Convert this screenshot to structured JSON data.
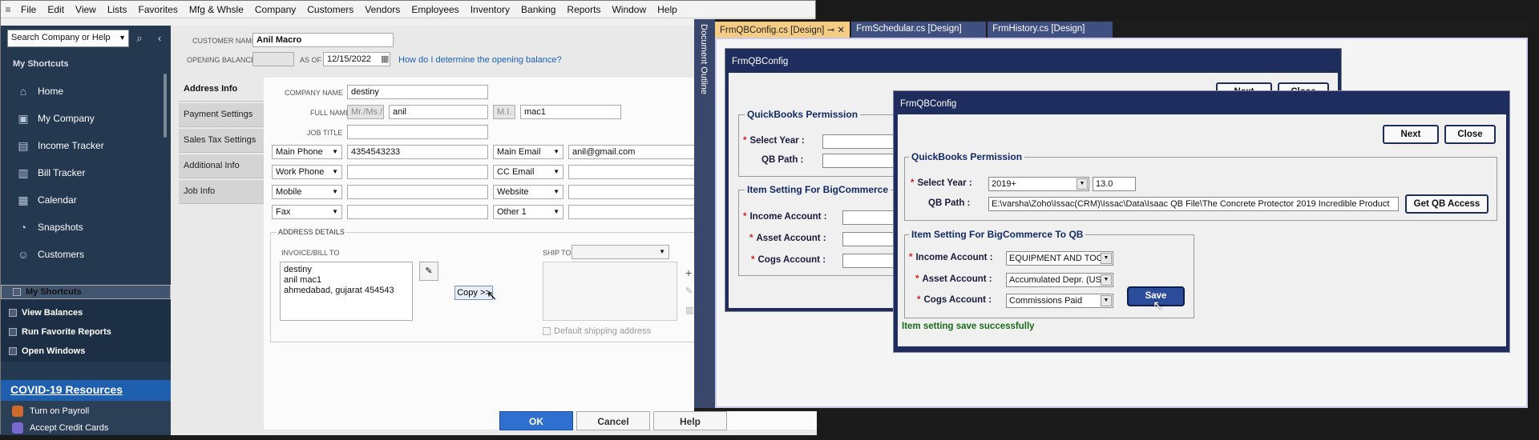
{
  "menu": [
    "File",
    "Edit",
    "View",
    "Lists",
    "Favorites",
    "Mfg & Whsle",
    "Company",
    "Customers",
    "Vendors",
    "Employees",
    "Inventory",
    "Banking",
    "Reports",
    "Window",
    "Help"
  ],
  "sidebar": {
    "search_placeholder": "Search Company or Help",
    "my_shortcuts_title": "My Shortcuts",
    "nav_items": [
      {
        "label": "Home",
        "icon": "home-icon",
        "glyph": "⌂"
      },
      {
        "label": "My Company",
        "icon": "company-icon",
        "glyph": "▣"
      },
      {
        "label": "Income Tracker",
        "icon": "income-tracker-icon",
        "glyph": "▤"
      },
      {
        "label": "Bill Tracker",
        "icon": "bill-tracker-icon",
        "glyph": "▥"
      },
      {
        "label": "Calendar",
        "icon": "calendar-icon",
        "glyph": "▦"
      },
      {
        "label": "Snapshots",
        "icon": "snapshots-icon",
        "glyph": "◔"
      },
      {
        "label": "Customers",
        "icon": "customers-icon",
        "glyph": "☺"
      }
    ],
    "shortcut_rows": [
      "My Shortcuts",
      "View Balances",
      "Run Favorite Reports",
      "Open Windows"
    ],
    "covid": "COVID-19 Resources",
    "payroll": "Turn on Payroll",
    "credit_cards": "Accept Credit Cards"
  },
  "customer": {
    "name_label": "CUSTOMER NAME",
    "name": "Anil Macro",
    "opening_balance_label": "OPENING BALANCE",
    "as_of_label": "AS OF",
    "as_of_date": "12/15/2022",
    "help_link": "How do I determine the opening balance?"
  },
  "tabs": [
    "Address Info",
    "Payment Settings",
    "Sales Tax Settings",
    "Additional Info",
    "Job Info"
  ],
  "address_info": {
    "company_label": "COMPANY NAME",
    "company": "destiny",
    "full_name_label": "FULL NAME",
    "mr_placeholder": "Mr./Ms./...",
    "first_name": "anil",
    "mi_placeholder": "M.I.",
    "last_name": "mac1",
    "job_title_label": "JOB TITLE",
    "phones": [
      {
        "type": "Main Phone",
        "value": "4354543233",
        "type2": "Main Email",
        "value2": "anil@gmail.com"
      },
      {
        "type": "Work Phone",
        "value": "",
        "type2": "CC Email",
        "value2": ""
      },
      {
        "type": "Mobile",
        "value": "",
        "type2": "Website",
        "value2": ""
      },
      {
        "type": "Fax",
        "value": "",
        "type2": "Other 1",
        "value2": ""
      }
    ],
    "address_details_label": "ADDRESS DETAILS",
    "invoice_bill_to_label": "INVOICE/BILL TO",
    "bill_to_lines": [
      "destiny",
      "anil mac1",
      "ahmedabad, gujarat 454543"
    ],
    "copy_label": "Copy >>",
    "ship_to_label": "SHIP TO",
    "default_shipping": "Default shipping address"
  },
  "buttons": {
    "ok": "OK",
    "cancel": "Cancel",
    "help": "Help"
  },
  "vs": {
    "doc_outline": "Document Outline",
    "tabs": [
      "FrmQBConfig.cs [Design]",
      "FrmSchedular.cs [Design]",
      "FrmHistory.cs [Design]"
    ],
    "form_title": "FrmQBConfig",
    "back_next": "Next",
    "back_close": "Close",
    "qb_permission": "QuickBooks Permission",
    "select_year_label": "Select Year :",
    "qb_path_label": "QB Path :",
    "item_setting_back": "Item Setting For BigCommerce",
    "item_setting": "Item Setting For BigCommerce To QB",
    "income_label": "Income Account :",
    "asset_label": "Asset Account :",
    "cogs_label": "Cogs Account :",
    "year_value": "2019+",
    "version_value": "13.0",
    "qb_path_value": "E:\\varsha\\Zoho\\Issac(CRM)\\Issac\\Data\\Isaac QB File\\The Concrete Protector 2019 Incredible Product",
    "get_qb_access": "Get QB Access",
    "income_value": "EQUIPMENT AND TOOLI",
    "asset_value": "Accumulated Depr. (USS",
    "cogs_value": "Commissions Paid",
    "save": "Save",
    "message": "Item setting save successfully"
  },
  "colors": {
    "qb_sidebar": "#243850",
    "vs_form": "#1e2d5e",
    "ok_blue": "#2e6fd0",
    "active_tab": "#f5cc84"
  }
}
